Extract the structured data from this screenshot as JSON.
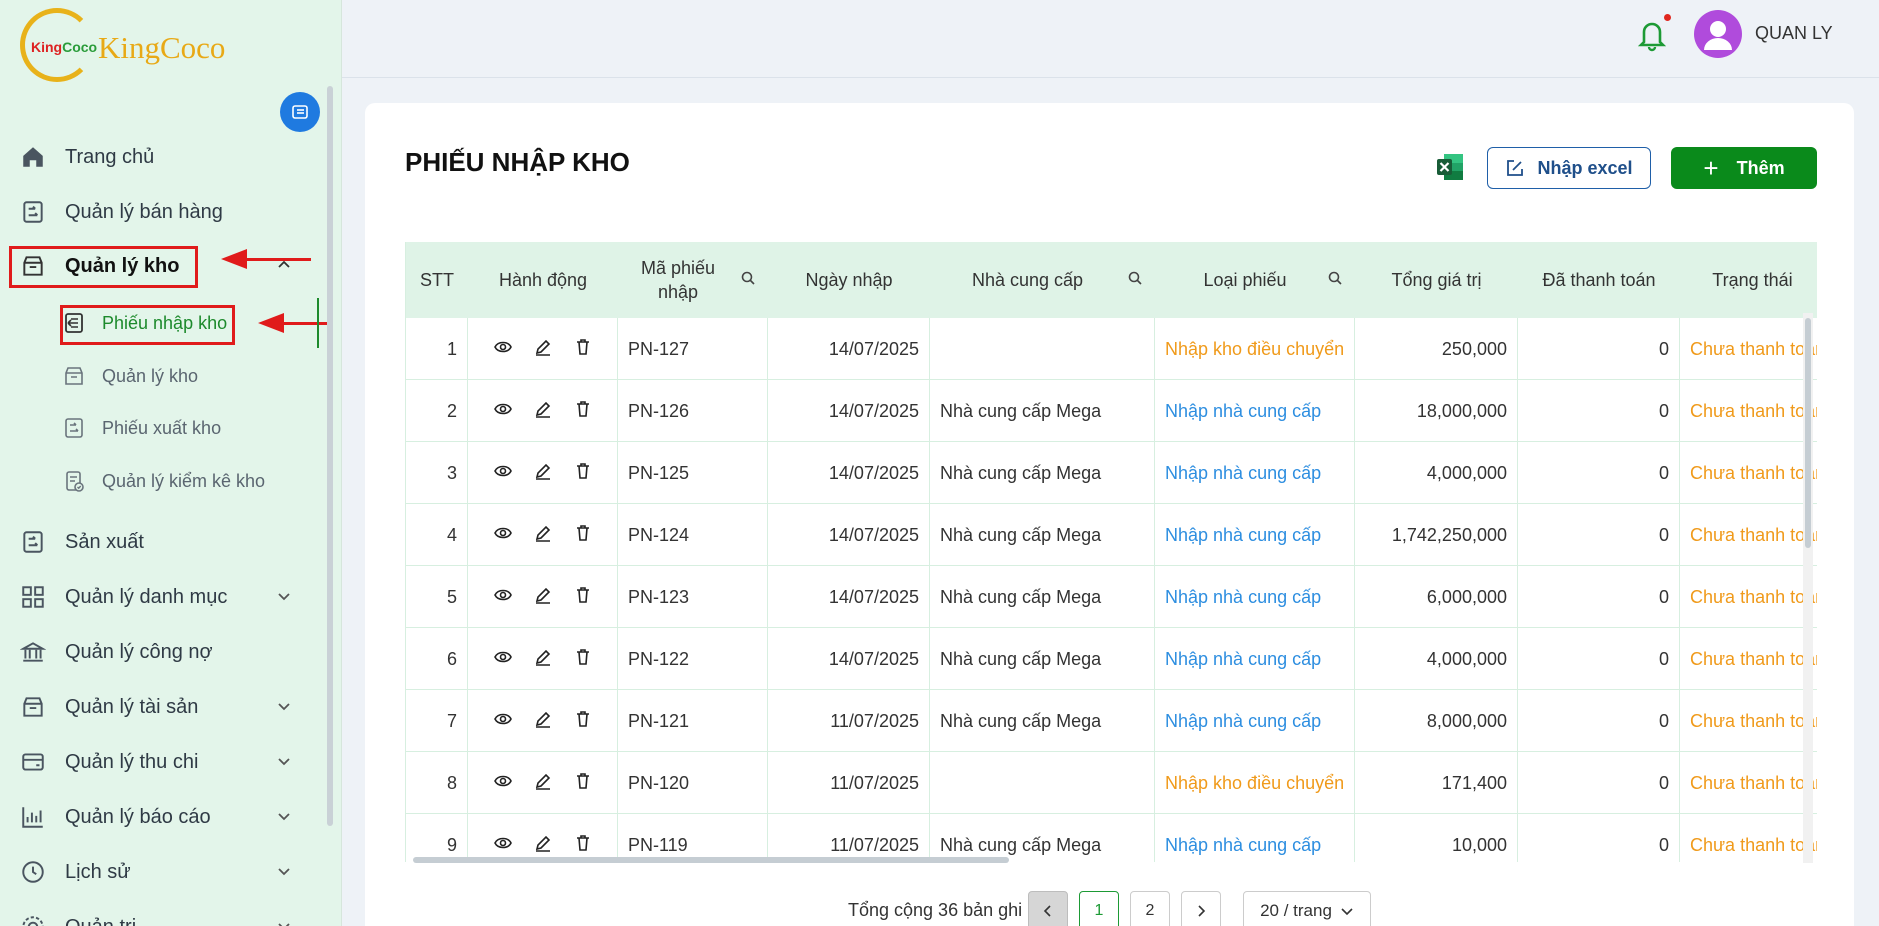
{
  "brand": {
    "logo_inner_red": "King",
    "logo_inner_green": "Coco",
    "name": "KingCoco"
  },
  "user": {
    "name": "QUAN LY"
  },
  "sidebar": {
    "items": [
      {
        "label": "Trang chủ",
        "icon": "home-icon"
      },
      {
        "label": "Quản lý bán hàng",
        "icon": "sales-icon"
      },
      {
        "label": "Quản lý kho",
        "icon": "warehouse-icon",
        "expanded": true
      },
      {
        "label": "Sản xuất",
        "icon": "production-icon"
      },
      {
        "label": "Quản lý danh mục",
        "icon": "grid-icon"
      },
      {
        "label": "Quản lý công nợ",
        "icon": "bank-icon"
      },
      {
        "label": "Quản lý tài sản",
        "icon": "asset-icon"
      },
      {
        "label": "Quản lý thu chi",
        "icon": "wallet-icon"
      },
      {
        "label": "Quản lý báo cáo",
        "icon": "report-icon"
      },
      {
        "label": "Lịch sử",
        "icon": "history-icon"
      },
      {
        "label": "Quản trị",
        "icon": "admin-icon"
      }
    ],
    "sub_items": [
      {
        "label": "Phiếu nhập kho",
        "active": true
      },
      {
        "label": "Quản lý kho"
      },
      {
        "label": "Phiếu xuất kho"
      },
      {
        "label": "Quản lý kiểm kê kho"
      }
    ]
  },
  "page": {
    "title": "PHIẾU NHẬP KHO",
    "import_label": "Nhập excel",
    "add_label": "Thêm"
  },
  "table": {
    "headers": [
      "STT",
      "Hành động",
      "Mã phiếu nhập",
      "Ngày nhập",
      "Nhà cung cấp",
      "Loại phiếu",
      "Tổng giá trị",
      "Đã thanh toán",
      "Trạng thái"
    ],
    "rows": [
      {
        "stt": "1",
        "code": "PN-127",
        "date": "14/07/2025",
        "supplier": "",
        "type": "Nhập kho điều chuyển",
        "type_kind": "transfer",
        "total": "250,000",
        "paid": "0",
        "status": "Chưa thanh toán"
      },
      {
        "stt": "2",
        "code": "PN-126",
        "date": "14/07/2025",
        "supplier": "Nhà cung cấp Mega",
        "type": "Nhập nhà cung cấp",
        "type_kind": "supplier",
        "total": "18,000,000",
        "paid": "0",
        "status": "Chưa thanh toán"
      },
      {
        "stt": "3",
        "code": "PN-125",
        "date": "14/07/2025",
        "supplier": "Nhà cung cấp Mega",
        "type": "Nhập nhà cung cấp",
        "type_kind": "supplier",
        "total": "4,000,000",
        "paid": "0",
        "status": "Chưa thanh toán"
      },
      {
        "stt": "4",
        "code": "PN-124",
        "date": "14/07/2025",
        "supplier": "Nhà cung cấp Mega",
        "type": "Nhập nhà cung cấp",
        "type_kind": "supplier",
        "total": "1,742,250,000",
        "paid": "0",
        "status": "Chưa thanh toán"
      },
      {
        "stt": "5",
        "code": "PN-123",
        "date": "14/07/2025",
        "supplier": "Nhà cung cấp Mega",
        "type": "Nhập nhà cung cấp",
        "type_kind": "supplier",
        "total": "6,000,000",
        "paid": "0",
        "status": "Chưa thanh toán"
      },
      {
        "stt": "6",
        "code": "PN-122",
        "date": "14/07/2025",
        "supplier": "Nhà cung cấp Mega",
        "type": "Nhập nhà cung cấp",
        "type_kind": "supplier",
        "total": "4,000,000",
        "paid": "0",
        "status": "Chưa thanh toán"
      },
      {
        "stt": "7",
        "code": "PN-121",
        "date": "11/07/2025",
        "supplier": "Nhà cung cấp Mega",
        "type": "Nhập nhà cung cấp",
        "type_kind": "supplier",
        "total": "8,000,000",
        "paid": "0",
        "status": "Chưa thanh toán"
      },
      {
        "stt": "8",
        "code": "PN-120",
        "date": "11/07/2025",
        "supplier": "",
        "type": "Nhập kho điều chuyển",
        "type_kind": "transfer",
        "total": "171,400",
        "paid": "0",
        "status": "Chưa thanh toán"
      },
      {
        "stt": "9",
        "code": "PN-119",
        "date": "11/07/2025",
        "supplier": "Nhà cung cấp Mega",
        "type": "Nhập nhà cung cấp",
        "type_kind": "supplier",
        "total": "10,000",
        "paid": "0",
        "status": "Chưa thanh toán"
      }
    ]
  },
  "pagination": {
    "total_text": "Tổng cộng 36 bản ghi",
    "current_page": "1",
    "page_2": "2",
    "page_size": "20 / trang"
  },
  "colors": {
    "accent_green": "#0a8a1b",
    "transfer": "#f09a1a",
    "supplier": "#2d8ee0",
    "status_unpaid": "#f09a1a"
  }
}
